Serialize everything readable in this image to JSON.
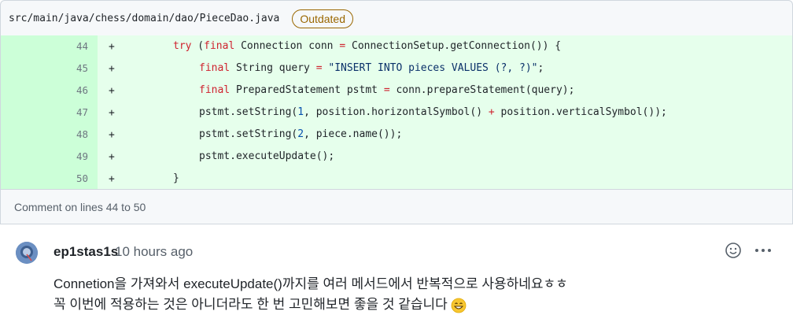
{
  "file": {
    "path": "src/main/java/chess/domain/dao/PieceDao.java",
    "badge": "Outdated"
  },
  "diff": {
    "lines": [
      {
        "num": "44",
        "sign": "+"
      },
      {
        "num": "45",
        "sign": "+"
      },
      {
        "num": "46",
        "sign": "+"
      },
      {
        "num": "47",
        "sign": "+"
      },
      {
        "num": "48",
        "sign": "+"
      },
      {
        "num": "49",
        "sign": "+"
      },
      {
        "num": "50",
        "sign": "+"
      }
    ],
    "code": {
      "l44_kw1": "try",
      "l44_mid": " (",
      "l44_kw2": "final",
      "l44_rest": " Connection conn ",
      "l44_op": "=",
      "l44_end": " ConnectionSetup.getConnection()) {",
      "l45_kw": "final",
      "l45_mid": " String query ",
      "l45_op": "=",
      "l45_str": " \"INSERT INTO pieces VALUES (?, ?)\"",
      "l45_end": ";",
      "l46_kw": "final",
      "l46_mid": " PreparedStatement pstmt ",
      "l46_op": "=",
      "l46_end": " conn.prepareStatement(query);",
      "l47_a": "pstmt.setString(",
      "l47_num": "1",
      "l47_b": ", position.horizontalSymbol() ",
      "l47_op": "+",
      "l47_c": " position.verticalSymbol());",
      "l48_a": "pstmt.setString(",
      "l48_num": "2",
      "l48_b": ", piece.name());",
      "l49": "pstmt.executeUpdate();",
      "l50": "}"
    }
  },
  "comment_bar": {
    "text": "Comment on lines 44 to 50"
  },
  "comment": {
    "author": "ep1stas1s",
    "time": "10 hours ago",
    "line1": "Connetion을 가져와서 executeUpdate()까지를 여러 메서드에서 반복적으로 사용하네요ㅎㅎ",
    "line2": "꼭 이번에 적용하는 것은 아니더라도 한 번 고민해보면 좋을 것 같습니다",
    "icons": {
      "reaction": "smiley-icon",
      "menu": "kebab-horizontal-icon",
      "avatar": "avatar",
      "inline": "grinning-emoji"
    }
  }
}
